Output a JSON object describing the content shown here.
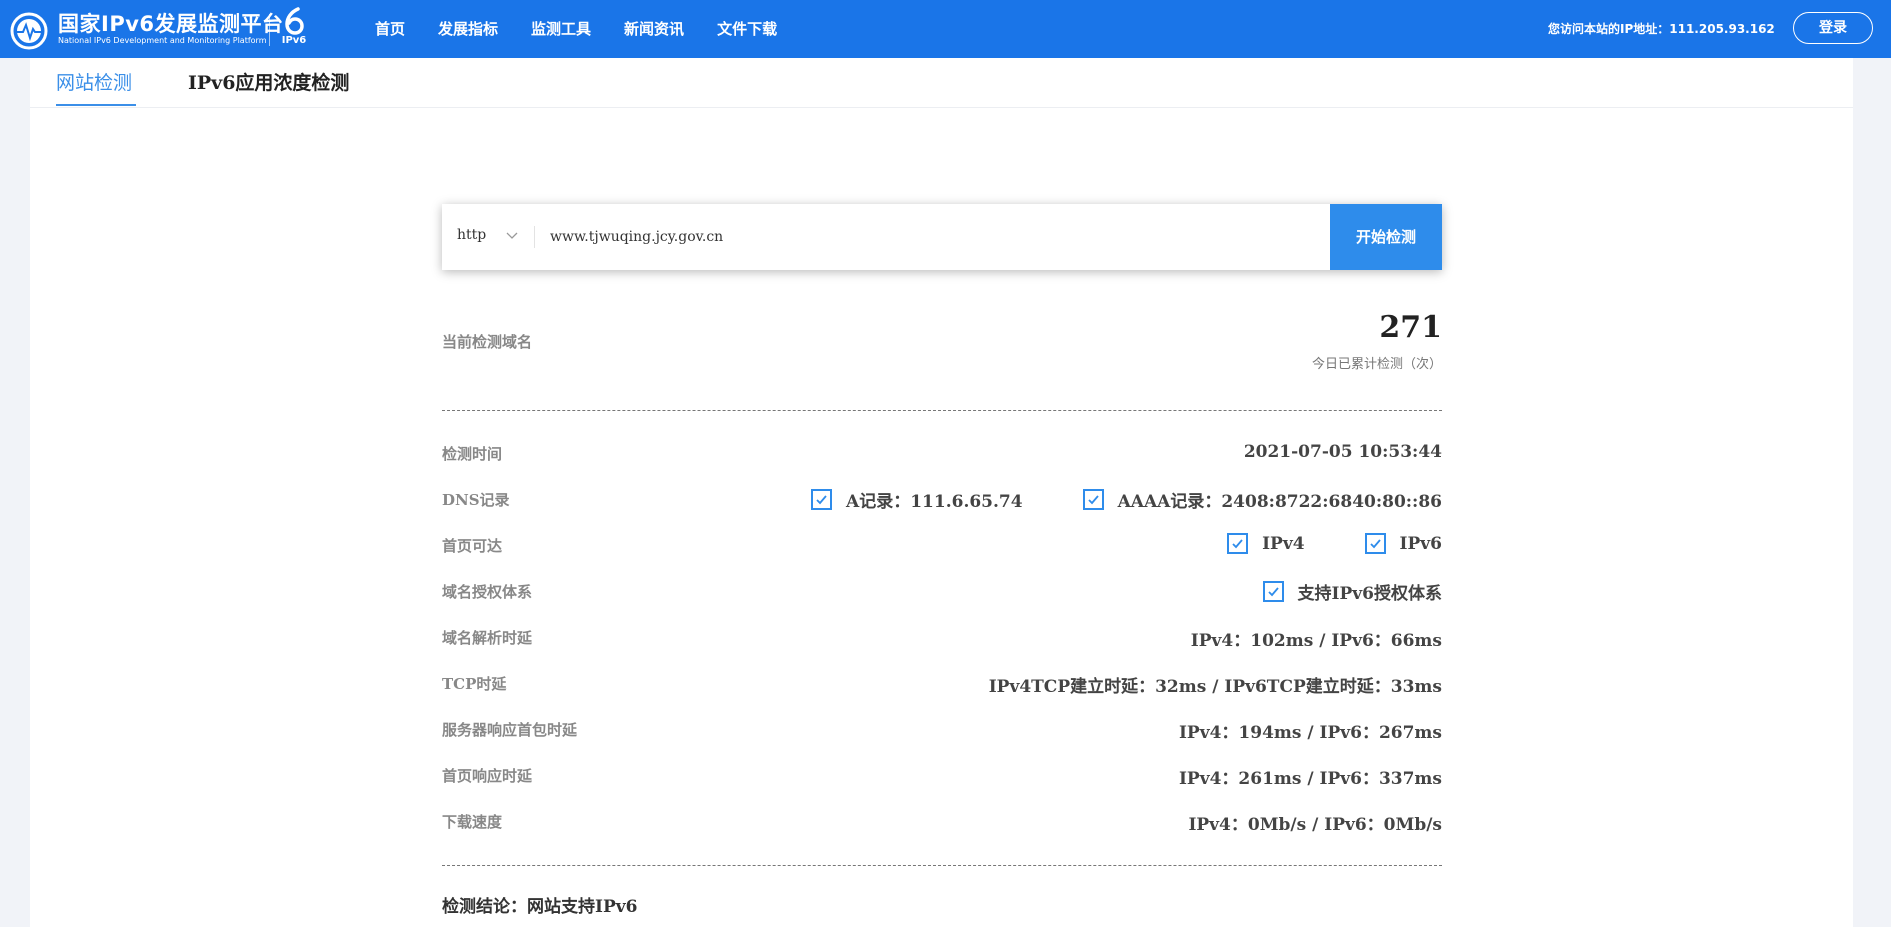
{
  "header": {
    "title": "国家IPv6发展监测平台",
    "subtitle": "National IPv6 Development and Monitoring Platform",
    "ipv6_logo_text": "IPv6",
    "nav": [
      "首页",
      "发展指标",
      "监测工具",
      "新闻资讯",
      "文件下载"
    ],
    "visitor_ip": "您访问本站的IP地址：111.205.93.162",
    "login": "登录"
  },
  "tabs": [
    {
      "label": "网站检测",
      "active": true
    },
    {
      "label": "IPv6应用浓度检测",
      "active": false
    }
  ],
  "search": {
    "protocol": "http",
    "url": "www.tjwuqing.jcy.gov.cn",
    "button": "开始检测"
  },
  "summary": {
    "current_domain_label": "当前检测域名",
    "count": "271",
    "count_label": "今日已累计检测（次）"
  },
  "results": {
    "time": {
      "label": "检测时间",
      "value": "2021-07-05 10:53:44"
    },
    "dns": {
      "label": "DNS记录",
      "a": "A记录：111.6.65.74",
      "aaaa": "AAAA记录：2408:8722:6840:80::86"
    },
    "homepage": {
      "label": "首页可达",
      "ipv4": "IPv4",
      "ipv6": "IPv6"
    },
    "auth": {
      "label": "域名授权体系",
      "value": "支持IPv6授权体系"
    },
    "dns_latency": {
      "label": "域名解析时延",
      "value": "IPv4：102ms / IPv6：66ms"
    },
    "tcp": {
      "label": "TCP时延",
      "value": "IPv4TCP建立时延：32ms / IPv6TCP建立时延：33ms"
    },
    "first_packet": {
      "label": "服务器响应首包时延",
      "value": "IPv4：194ms / IPv6：267ms"
    },
    "homepage_latency": {
      "label": "首页响应时延",
      "value": "IPv4：261ms / IPv6：337ms"
    },
    "download": {
      "label": "下载速度",
      "value": "IPv4：0Mb/s / IPv6：0Mb/s"
    }
  },
  "conclusion": "检测结论：网站支持IPv6",
  "colors": {
    "brand": "#1a75e8",
    "accent": "#2e8ceb"
  }
}
